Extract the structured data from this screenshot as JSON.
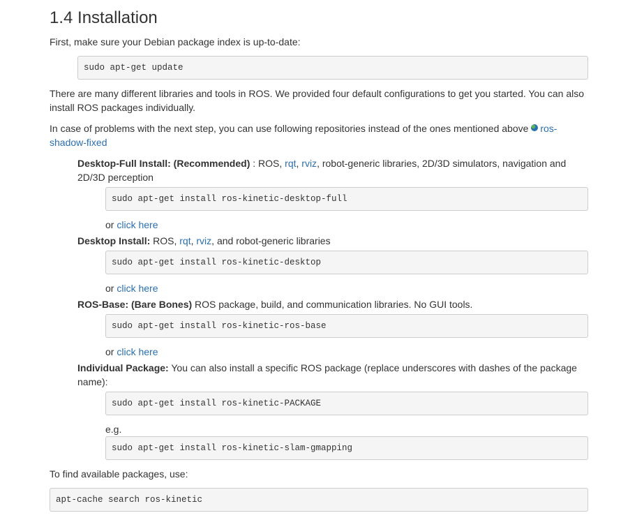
{
  "heading": "1.4 Installation",
  "intro": "First, make sure your Debian package index is up-to-date:",
  "cmd_update": "sudo apt-get update",
  "para_configs": "There are many different libraries and tools in ROS. We provided four default configurations to get you started. You can also install ROS packages individually.",
  "para_repos": {
    "text": "In case of problems with the next step, you can use following repositories instead of the ones mentioned above",
    "link": "ros-shadow-fixed",
    "icon": "globe-icon"
  },
  "desktop_full": {
    "label": "Desktop-Full Install: (Recommended)",
    "pre": " : ROS, ",
    "rqt": "rqt",
    "rviz": "rviz",
    "post": ", robot-generic libraries, 2D/3D simulators, navigation and 2D/3D perception",
    "cmd": "sudo apt-get install ros-kinetic-desktop-full",
    "or": "or ",
    "click": "click here"
  },
  "desktop": {
    "label": "Desktop Install:",
    "pre": " ROS, ",
    "rqt": "rqt",
    "rviz": "rviz",
    "post": ", and robot-generic libraries",
    "cmd": "sudo apt-get install ros-kinetic-desktop",
    "or": "or ",
    "click": "click here"
  },
  "ros_base": {
    "label": "ROS-Base: (Bare Bones)",
    "post": " ROS package, build, and communication libraries. No GUI tools.",
    "cmd": "sudo apt-get install ros-kinetic-ros-base",
    "or": "or ",
    "click": "click here"
  },
  "individual": {
    "label": "Individual Package:",
    "post": " You can also install a specific ROS package (replace underscores with dashes of the package name):",
    "cmd": "sudo apt-get install ros-kinetic-PACKAGE",
    "eg": "e.g.",
    "cmd_eg": "sudo apt-get install ros-kinetic-slam-gmapping"
  },
  "find_text": "To find available packages, use:",
  "cmd_search": "apt-cache search ros-kinetic",
  "colors": {
    "link": "#2a6fb0",
    "text": "#333333",
    "code_bg": "#f5f5f5",
    "code_border": "#cccccc"
  }
}
